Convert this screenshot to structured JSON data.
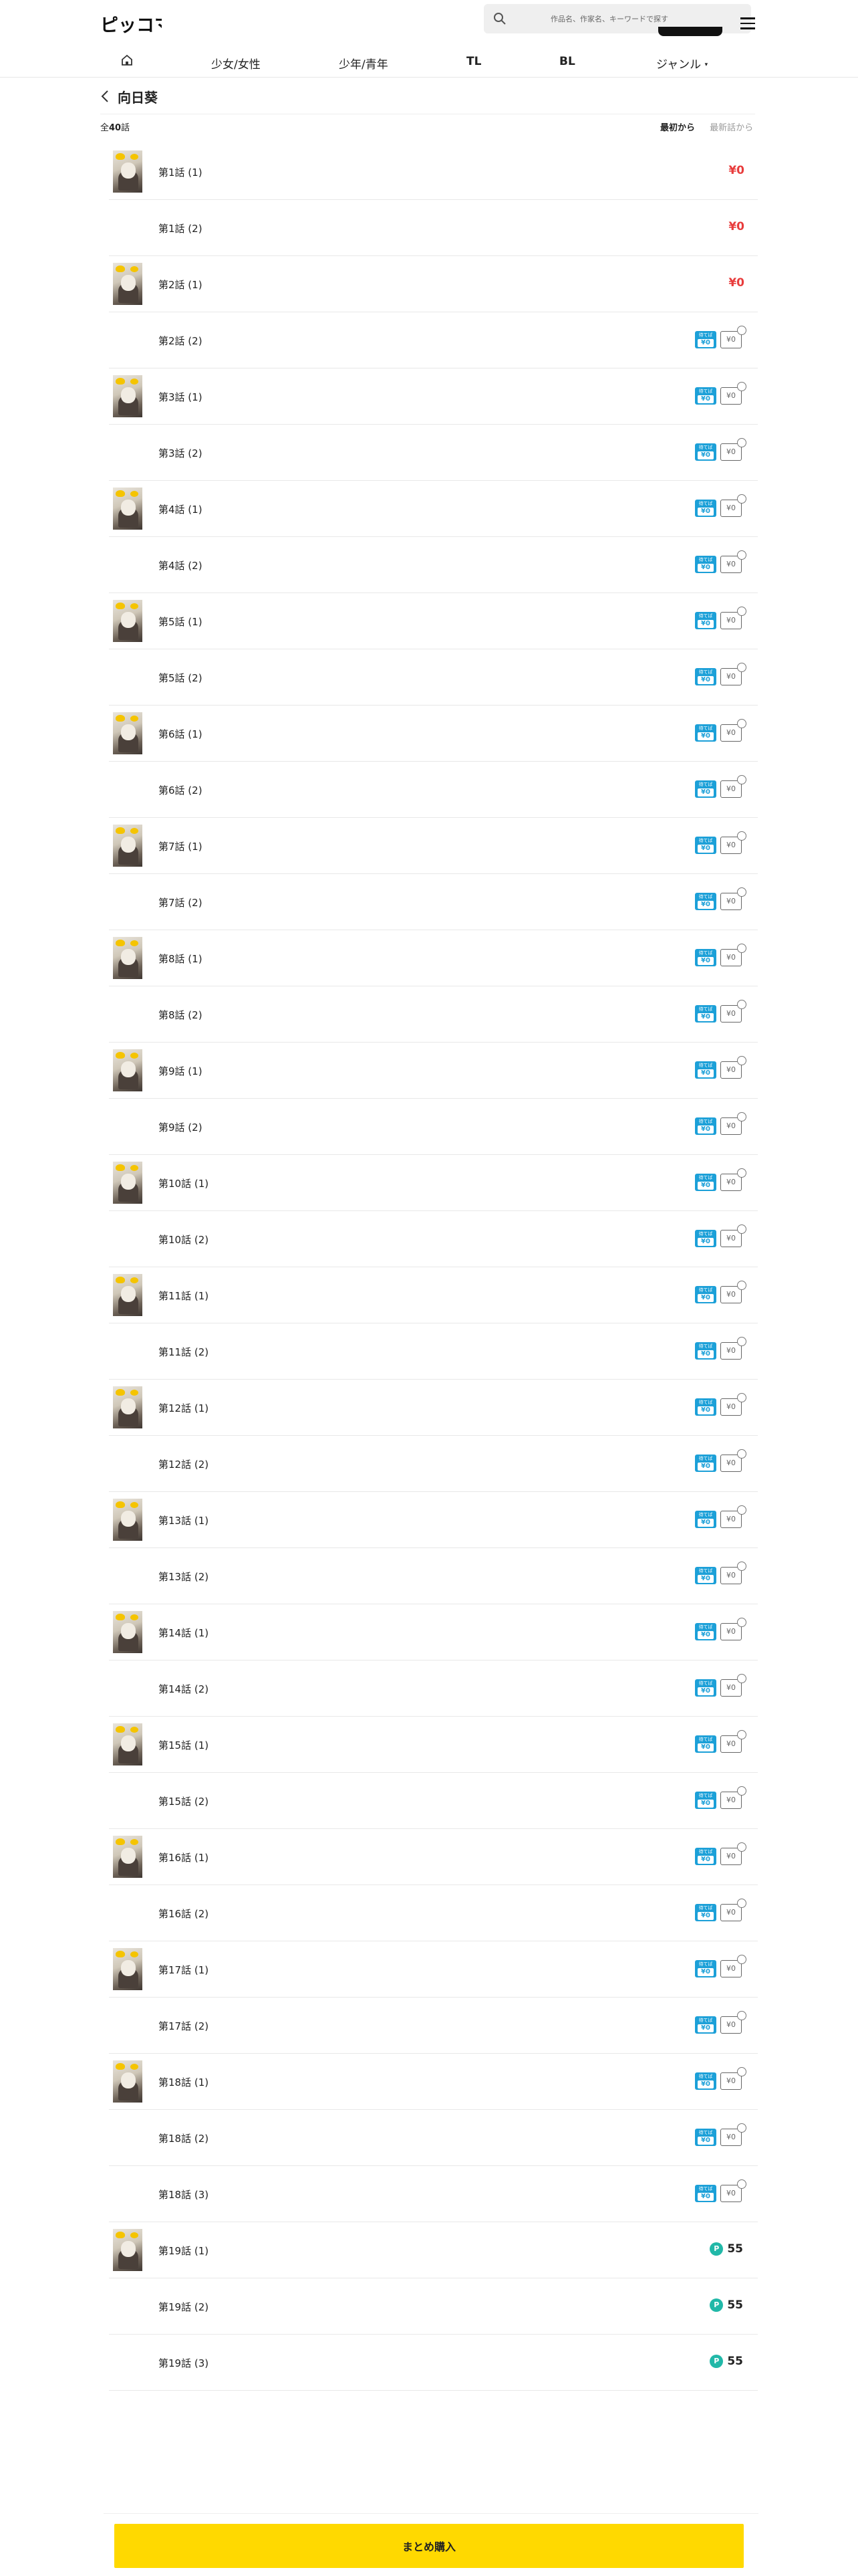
{
  "header": {
    "logo_text": "ピッコマ",
    "search_placeholder": "作品名、作家名、キーワードで探す"
  },
  "nav": {
    "home_icon": "home-icon",
    "items": [
      "少女/女性",
      "少年/青年",
      "TL",
      "BL",
      "ジャンル"
    ]
  },
  "title": "向日葵",
  "total": {
    "prefix": "全",
    "count": "40",
    "suffix": "話"
  },
  "sort": {
    "oldest": "最初から",
    "newest": "最新話から"
  },
  "episodes": [
    {
      "label": "第1話 (1)",
      "thumb": true,
      "price": "¥0",
      "type": "red"
    },
    {
      "label": "第1話 (2)",
      "thumb": false,
      "price": "¥0",
      "type": "red"
    },
    {
      "label": "第2話 (1)",
      "thumb": true,
      "price": "¥0",
      "type": "red"
    },
    {
      "label": "第2話 (2)",
      "thumb": false,
      "type": "badge"
    },
    {
      "label": "第3話 (1)",
      "thumb": true,
      "type": "badge"
    },
    {
      "label": "第3話 (2)",
      "thumb": false,
      "type": "badge"
    },
    {
      "label": "第4話 (1)",
      "thumb": true,
      "type": "badge"
    },
    {
      "label": "第4話 (2)",
      "thumb": false,
      "type": "badge"
    },
    {
      "label": "第5話 (1)",
      "thumb": true,
      "type": "badge"
    },
    {
      "label": "第5話 (2)",
      "thumb": false,
      "type": "badge"
    },
    {
      "label": "第6話 (1)",
      "thumb": true,
      "type": "badge"
    },
    {
      "label": "第6話 (2)",
      "thumb": false,
      "type": "badge"
    },
    {
      "label": "第7話 (1)",
      "thumb": true,
      "type": "badge"
    },
    {
      "label": "第7話 (2)",
      "thumb": false,
      "type": "badge"
    },
    {
      "label": "第8話 (1)",
      "thumb": true,
      "type": "badge"
    },
    {
      "label": "第8話 (2)",
      "thumb": false,
      "type": "badge"
    },
    {
      "label": "第9話 (1)",
      "thumb": true,
      "type": "badge"
    },
    {
      "label": "第9話 (2)",
      "thumb": false,
      "type": "badge"
    },
    {
      "label": "第10話 (1)",
      "thumb": true,
      "type": "badge"
    },
    {
      "label": "第10話 (2)",
      "thumb": false,
      "type": "badge"
    },
    {
      "label": "第11話 (1)",
      "thumb": true,
      "type": "badge"
    },
    {
      "label": "第11話 (2)",
      "thumb": false,
      "type": "badge"
    },
    {
      "label": "第12話 (1)",
      "thumb": true,
      "type": "badge"
    },
    {
      "label": "第12話 (2)",
      "thumb": false,
      "type": "badge"
    },
    {
      "label": "第13話 (1)",
      "thumb": true,
      "type": "badge"
    },
    {
      "label": "第13話 (2)",
      "thumb": false,
      "type": "badge"
    },
    {
      "label": "第14話 (1)",
      "thumb": true,
      "type": "badge"
    },
    {
      "label": "第14話 (2)",
      "thumb": false,
      "type": "badge"
    },
    {
      "label": "第15話 (1)",
      "thumb": true,
      "type": "badge"
    },
    {
      "label": "第15話 (2)",
      "thumb": false,
      "type": "badge"
    },
    {
      "label": "第16話 (1)",
      "thumb": true,
      "type": "badge"
    },
    {
      "label": "第16話 (2)",
      "thumb": false,
      "type": "badge"
    },
    {
      "label": "第17話 (1)",
      "thumb": true,
      "type": "badge"
    },
    {
      "label": "第17話 (2)",
      "thumb": false,
      "type": "badge"
    },
    {
      "label": "第18話 (1)",
      "thumb": true,
      "type": "badge"
    },
    {
      "label": "第18話 (2)",
      "thumb": false,
      "type": "badge"
    },
    {
      "label": "第18話 (3)",
      "thumb": false,
      "type": "badge"
    },
    {
      "label": "第19話 (1)",
      "thumb": true,
      "price": "55",
      "type": "coin"
    },
    {
      "label": "第19話 (2)",
      "thumb": false,
      "price": "55",
      "type": "coin"
    },
    {
      "label": "第19話 (3)",
      "thumb": false,
      "price": "55",
      "type": "coin"
    }
  ],
  "badge_text": {
    "wait_free_top": "待てば",
    "wait_free_price": "¥0",
    "outline_price": "¥0",
    "coin_symbol": "P"
  },
  "colors": {
    "accent_yellow": "#ffd900",
    "price_red": "#e83c3c",
    "badge_blue": "#1ca0d8",
    "coin_teal": "#21b8a8"
  },
  "footer": {
    "bulk_purchase": "まとめ購入"
  }
}
